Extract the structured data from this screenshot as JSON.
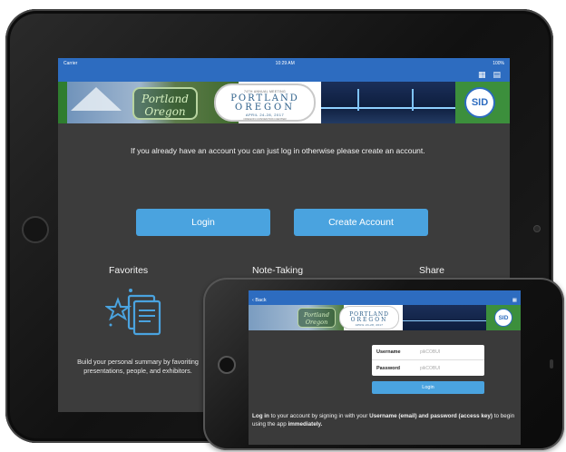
{
  "tablet": {
    "status_bar": {
      "carrier": "Carrier",
      "time": "10:29 AM",
      "battery": "100%"
    },
    "nav_icons": [
      "calendar-icon",
      "list-icon"
    ],
    "banner": {
      "script_text": "Portland Oregon",
      "small_text": "74TH ANNUAL MEETING",
      "city": "PORTLAND",
      "state": "OREGON",
      "date": "APRIL 24-28, 2017",
      "sub_text": "OREGON CONVENTION CENTER",
      "logo": "SID"
    },
    "intro_text": "If you already have an account you can just log in otherwise please create an account.",
    "buttons": {
      "login": "Login",
      "create_account": "Create Account"
    },
    "features": {
      "favorites": "Favorites",
      "note_taking": "Note-Taking",
      "share": "Share"
    },
    "favorites_description": "Build your personal summary by favoriting presentations, people, and exhibitors.",
    "colors": {
      "accent": "#4aa3df",
      "nav": "#2d6cc0",
      "background": "#3c3c3c"
    }
  },
  "phone": {
    "nav": {
      "back": "Back",
      "icon": "calendar-icon"
    },
    "banner": {
      "script_text": "Portland Oregon",
      "city": "PORTLAND",
      "state": "OREGON",
      "date": "APRIL 24-28, 2017",
      "logo": "SID"
    },
    "form": {
      "username_label": "Username",
      "username_placeholder": "pikCOBUI",
      "password_label": "Password",
      "password_placeholder": "pikCOBUI"
    },
    "login_button": "Login",
    "info": {
      "part1": "Log in",
      "part2": " to your account by signing in with your ",
      "part3": "Username (email) and password (access key)",
      "part4": " to begin using the app ",
      "part5": "immediately."
    }
  }
}
